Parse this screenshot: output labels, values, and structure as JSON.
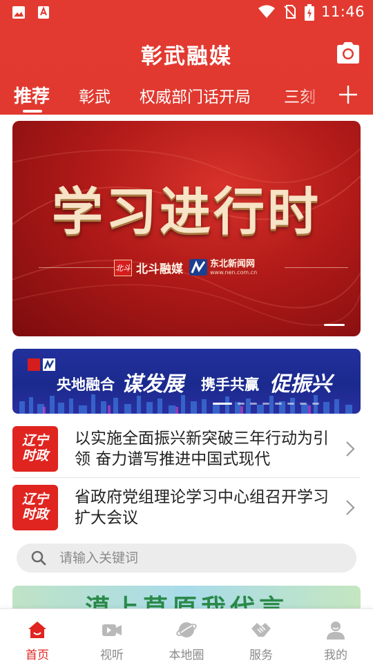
{
  "status_bar": {
    "time": "11:46",
    "left_icons": [
      "image-icon",
      "app-notification-icon"
    ],
    "right_icons": [
      "wifi-icon",
      "no-sim-icon",
      "battery-charging-icon"
    ]
  },
  "header": {
    "title": "彰武融媒",
    "camera_icon": "camera-icon",
    "tabs": [
      {
        "label": "推荐",
        "active": true
      },
      {
        "label": "彰武",
        "active": false
      },
      {
        "label": "权威部门话开局",
        "active": false
      },
      {
        "label": "三刻",
        "active": false
      }
    ],
    "add_tab_icon": "plus-icon"
  },
  "hero": {
    "title": "学习进行时",
    "logo1_seal": "北斗",
    "logo1_text": "北斗融媒",
    "logo2_text": "东北新闻网",
    "logo2_url": "www.nen.com.cn",
    "slide_count": 1,
    "active_slide": 1
  },
  "banner2": {
    "text1": "央地融合",
    "script1": "谋发展",
    "text2": "携手共赢",
    "script2": "促振兴",
    "active_dot": 1
  },
  "news": [
    {
      "badge_line1": "辽宁",
      "badge_line2": "时政",
      "title": "以实施全面振兴新突破三年行动为引领 奋力谱写推进中国式现代"
    },
    {
      "badge_line1": "辽宁",
      "badge_line2": "时政",
      "title": "省政府党组理论学习中心组召开学习扩大会议"
    }
  ],
  "search": {
    "placeholder": "请输入关键词",
    "icon": "search-icon"
  },
  "peek_card": {
    "text": "漠上草原我代言"
  },
  "bottom_nav": [
    {
      "label": "首页",
      "icon": "home-icon",
      "active": true
    },
    {
      "label": "视听",
      "icon": "video-camera-icon",
      "active": false
    },
    {
      "label": "本地圈",
      "icon": "planet-icon",
      "active": false
    },
    {
      "label": "服务",
      "icon": "handshake-icon",
      "active": false
    },
    {
      "label": "我的",
      "icon": "user-icon",
      "active": false
    }
  ],
  "colors": {
    "brand_red": "#e1392f",
    "nav_active": "#e0241f",
    "nav_inactive": "#8a8a8a",
    "banner2_blue": "#1a2a8e"
  }
}
